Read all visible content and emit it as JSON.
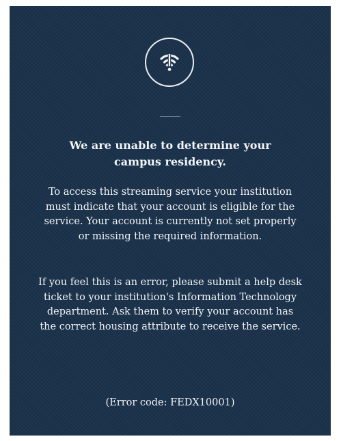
{
  "icon": "wifi-off-icon",
  "colors": {
    "background": "#1b324b",
    "text": "#f2f5f8"
  },
  "heading": "We are unable to determine your campus residency.",
  "paragraph_1": "To access this streaming service your institution must indicate that your account is eligible for the service. Your account is currently not set properly or missing the required information.",
  "paragraph_2": "If you feel this is an error, please submit a help desk ticket to your institution's Information Technology department. Ask them to verify your account has the correct housing attribute to receive the service.",
  "error_code": "(Error code: FEDX10001)"
}
